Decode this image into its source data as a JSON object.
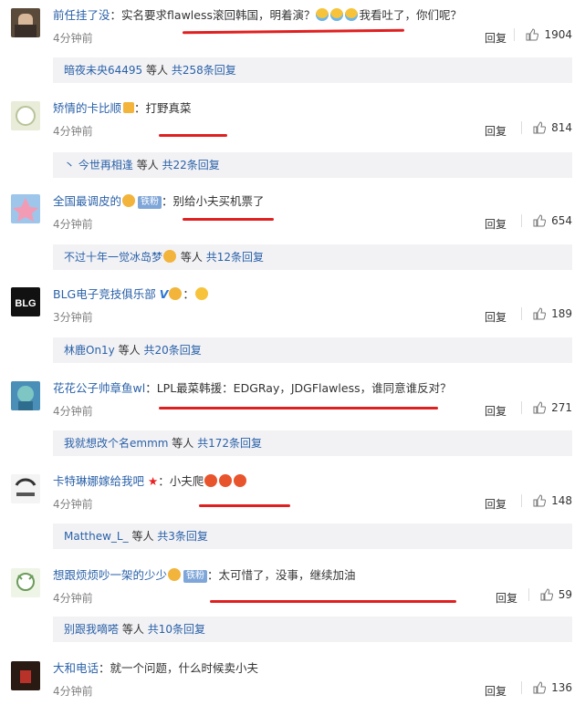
{
  "comments": [
    {
      "user": "前任挂了没",
      "text": "实名要求flawless滚回韩国，明着演？",
      "text2": "我看吐了，你们呢？",
      "time": "4分钟前",
      "reply": "回复",
      "likes": "1904",
      "sub": {
        "name": "暗夜未央64495",
        "mid": "等人",
        "count": "共258条回复"
      }
    },
    {
      "user": "矫情的卡比顺",
      "text": "打野真菜",
      "time": "4分钟前",
      "reply": "回复",
      "likes": "814",
      "sub": {
        "prefix": "丶",
        "name": "今世再相逢",
        "mid": "等人",
        "count": "共22条回复"
      }
    },
    {
      "user": "全国最调皮的",
      "badge": "铁粉",
      "text": "别给小夫买机票了",
      "time": "4分钟前",
      "reply": "回复",
      "likes": "654",
      "sub": {
        "name": "不过十年一觉冰岛梦",
        "mid": "等人",
        "count": "共12条回复"
      }
    },
    {
      "user": "BLG电子竞技俱乐部",
      "vip": "V",
      "text": "",
      "time": "3分钟前",
      "reply": "回复",
      "likes": "189",
      "sub": {
        "name": "林鹿On1y",
        "mid": "等人",
        "count": "共20条回复"
      }
    },
    {
      "user": "花花公子帅章鱼wl",
      "text": "LPL最菜韩援：EDGRay，JDGFlawless，谁同意谁反对？",
      "time": "4分钟前",
      "reply": "回复",
      "likes": "271",
      "sub": {
        "name": "我就想改个名emmm",
        "mid": "等人",
        "count": "共172条回复"
      }
    },
    {
      "user": "卡特琳娜嫁给我吧",
      "text": "小夫爬",
      "time": "4分钟前",
      "reply": "回复",
      "likes": "148",
      "sub": {
        "name": "Matthew_L_",
        "mid": "等人",
        "count": "共3条回复"
      }
    },
    {
      "user": "想跟烦烦吵一架的少少",
      "badge": "铁粉",
      "text": "太可惜了，没事，继续加油",
      "time": "4分钟前",
      "reply": "回复",
      "likes": "59",
      "sub": {
        "name": "别跟我嘀嗒",
        "mid": "等人",
        "count": "共10条回复"
      }
    },
    {
      "user": "大和电话",
      "text": "就一个问题，什么时候卖小夫",
      "time": "4分钟前",
      "reply": "回复",
      "likes": "136"
    }
  ],
  "colors": {
    "link": "#2a61a8",
    "underline": "#e02020",
    "subbg": "#f2f2f5"
  },
  "icons": {
    "like": "thumbs-up-icon",
    "fan_badge": "iron-fan-badge",
    "vip": "verified-v-icon"
  }
}
